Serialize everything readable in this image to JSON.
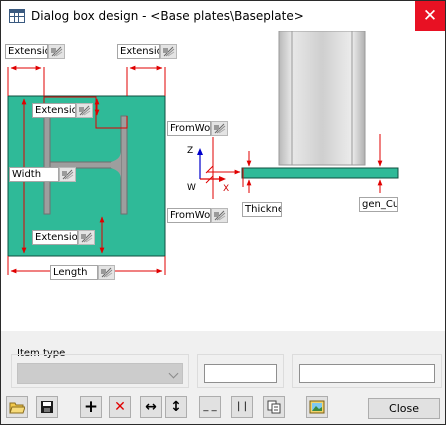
{
  "window": {
    "title": "Dialog box design - <Base plates\\Baseplate>",
    "close_glyph": "✕"
  },
  "design": {
    "fields": {
      "ext_top_left": "Extensio",
      "ext_top_right": "Extensio",
      "ext_inner_top": "Extensio",
      "width": "Width",
      "ext_inner_bottom": "Extension",
      "length": "Length",
      "from_work_upper": "FromWork",
      "from_work_lower": "FromWork",
      "thickness": "Thickness",
      "gen_cut": "gen_Cut"
    },
    "axes": {
      "z": "Z",
      "x": "X",
      "w": "W"
    },
    "colors": {
      "plate": "#2fba98",
      "dimension": "#e00000",
      "column": "#c8c8c8"
    }
  },
  "bottom": {
    "item_type_label": "Item type",
    "item_type_value": "",
    "value_field_1": "",
    "value_field_2": ""
  },
  "toolbar": {
    "buttons": [
      {
        "name": "open-folder-icon",
        "glyph": ""
      },
      {
        "name": "save-icon",
        "glyph": ""
      },
      {
        "name": "add-icon",
        "glyph": "+"
      },
      {
        "name": "delete-icon",
        "glyph": "✕"
      },
      {
        "name": "horizontal-dimension-icon",
        "glyph": "↔"
      },
      {
        "name": "vertical-dimension-icon",
        "glyph": "↕"
      },
      {
        "name": "horizontal-align-icon",
        "glyph": "_ _"
      },
      {
        "name": "vertical-align-icon",
        "glyph": "| |"
      },
      {
        "name": "copy-icon",
        "glyph": ""
      },
      {
        "name": "picture-icon",
        "glyph": ""
      }
    ],
    "close_label": "Close"
  }
}
